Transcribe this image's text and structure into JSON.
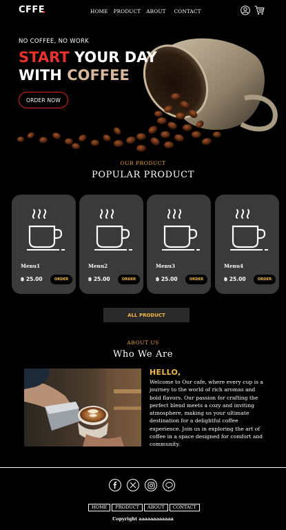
{
  "brand": {
    "logo": "CFFE"
  },
  "nav": {
    "links": [
      "HOME",
      "PRODUCT",
      "ABOUT",
      "CONTACT"
    ]
  },
  "icons": {
    "user": "user-icon",
    "cart": "cart-icon"
  },
  "hero": {
    "tagline": "NO COFFEE, NO WORK",
    "title_word_red": "START",
    "title_rest_line1": "YOUR DAY",
    "title_with": "WITH",
    "title_word_beige": "COFFEE",
    "cta": "ORDER NOW"
  },
  "products_section": {
    "eyebrow": "OUR PRODUCT",
    "title": "POPULAR PRODUCT",
    "items": [
      {
        "name": "Menu1",
        "price": "฿ 25.00",
        "order": "ORDER"
      },
      {
        "name": "Menu2",
        "price": "฿ 25.00",
        "order": "ORDER"
      },
      {
        "name": "Menu3",
        "price": "฿ 25.00",
        "order": "ORDER"
      },
      {
        "name": "Menu4",
        "price": "฿ 25.00",
        "order": "ORDER"
      }
    ],
    "all_button": "ALL PRODUCT"
  },
  "about": {
    "eyebrow": "ABOUT US",
    "title": "Who We Are",
    "greeting": "HELLO,",
    "body": "Welcome to Our cafe, where every cup is a journey to the world of rich aromas and bold flavors. Our passion for crafting the perfect blend meets a cozy and inviting atmosphere, making us your ultimate destination for a delightful coffee experience. Join us in exploring the art of coffee in a space designed for comfort and community."
  },
  "footer": {
    "socials": [
      "facebook-icon",
      "x-icon",
      "instagram-icon",
      "line-icon"
    ],
    "links": [
      "HOME",
      "PRODUCT",
      "ABOUT",
      "CONTACT"
    ],
    "copyright": "Copyright aaaaaaaaaaaa"
  },
  "colors": {
    "accent_red": "#e8322c",
    "accent_gold": "#f2b94b",
    "card_bg": "#3a3a3a"
  }
}
